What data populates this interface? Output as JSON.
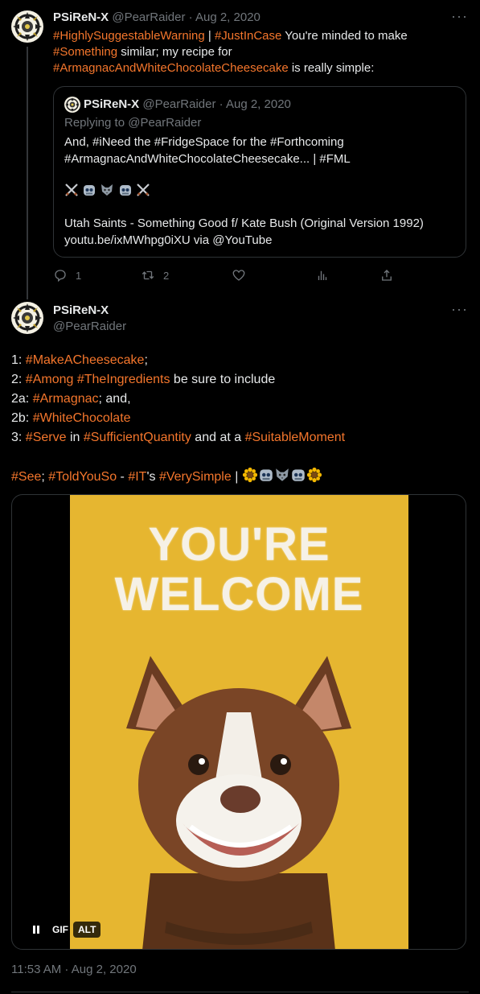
{
  "tweet1": {
    "name": "PSiReN-X",
    "handle": "@PearRaider",
    "date": "Aug 2, 2020",
    "more": "···",
    "line1": {
      "tag1": "#HighlySuggestableWarning",
      "sep": " | ",
      "tag2": "#JustInCase",
      "rest": " You're minded to make"
    },
    "line2": {
      "tag": "#Something",
      "rest": " similar; my recipe for"
    },
    "line3": {
      "tag": "#ArmagnacAndWhiteChocolateCheesecake",
      "rest": " is really simple:"
    }
  },
  "quote": {
    "name": "PSiReN-X",
    "handle": "@PearRaider",
    "date": "Aug 2, 2020",
    "replying": "Replying to @PearRaider",
    "line1": "And, #iNeed the #FridgeSpace for the #Forthcoming",
    "line2": "#ArmagnacAndWhiteChocolateCheesecake... | #FML",
    "line3": "Utah Saints - Something Good f/ Kate Bush (Original Version 1992)",
    "line4": "youtu.be/ixMWhpg0iXU via @YouTube"
  },
  "actions": {
    "replies": "1",
    "retweets": "2",
    "likes": "",
    "views": ""
  },
  "tweet2": {
    "name": "PSiReN-X",
    "handle": "@PearRaider",
    "more": "···",
    "l1": {
      "pre": "1: ",
      "tag": "#MakeACheesecake",
      "post": ";"
    },
    "l2": {
      "pre": "2: ",
      "tag1": "#Among",
      "sp": " ",
      "tag2": "#TheIngredients",
      "post": " be sure to include"
    },
    "l3": {
      "pre": "2a: ",
      "tag": "#Armagnac",
      "post": "; and,"
    },
    "l4": {
      "pre": "2b: ",
      "tag": "#WhiteChocolate"
    },
    "l5": {
      "pre": "3: ",
      "tag1": "#Serve",
      "mid1": " in ",
      "tag2": "#SufficientQuantity",
      "mid2": " and at a ",
      "tag3": "#SuitableMoment"
    },
    "l6": {
      "tag1": "#See",
      "mid1": "; ",
      "tag2": "#ToldYouSo",
      "mid2": " - ",
      "tag3": "#IT",
      "mid3": "'s ",
      "tag4": "#VerySimple",
      "post": " | "
    }
  },
  "media": {
    "headline1": "YOU'RE",
    "headline2": "WELCOME",
    "gif_label": "GIF",
    "alt_label": "ALT"
  },
  "timestamp": "11:53 AM · Aug 2, 2020",
  "colors": {
    "hashtag": "#f4762c",
    "muted": "#71767b",
    "gif_bg": "#e6b630"
  }
}
